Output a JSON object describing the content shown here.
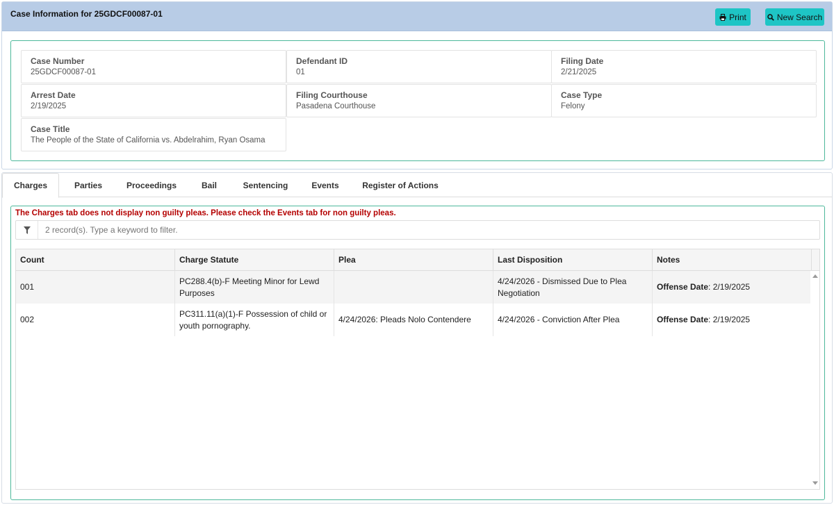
{
  "header": {
    "title": "Case Information for 25GDCF00087-01",
    "print_label": "Print",
    "new_search_label": "New Search"
  },
  "case_info": {
    "case_number": {
      "label": "Case Number",
      "value": "25GDCF00087-01"
    },
    "defendant_id": {
      "label": "Defendant ID",
      "value": "01"
    },
    "filing_date": {
      "label": "Filing Date",
      "value": "2/21/2025"
    },
    "arrest_date": {
      "label": "Arrest Date",
      "value": "2/19/2025"
    },
    "filing_courthouse": {
      "label": "Filing Courthouse",
      "value": "Pasadena Courthouse"
    },
    "case_type": {
      "label": "Case Type",
      "value": "Felony"
    },
    "case_title": {
      "label": "Case Title",
      "value": "The People of the State of California vs. Abdelrahim, Ryan Osama"
    }
  },
  "tabs": [
    {
      "label": "Charges",
      "active": true
    },
    {
      "label": "Parties",
      "active": false
    },
    {
      "label": "Proceedings",
      "active": false
    },
    {
      "label": "Bail",
      "active": false
    },
    {
      "label": "Sentencing",
      "active": false
    },
    {
      "label": "Events",
      "active": false
    },
    {
      "label": "Register of Actions",
      "active": false
    }
  ],
  "charges": {
    "warning": "The Charges tab does not display non guilty pleas. Please check the Events tab for non guilty pleas.",
    "filter_placeholder": "2 record(s). Type a keyword to filter.",
    "columns": [
      "Count",
      "Charge Statute",
      "Plea",
      "Last Disposition",
      "Notes"
    ],
    "rows": [
      {
        "count": "001",
        "statute": "PC288.4(b)-F Meeting Minor for Lewd Purposes",
        "plea": "",
        "disposition": "4/24/2026 - Dismissed Due to Plea Negotiation",
        "notes_label": "Offense Date",
        "notes_value": ": 2/19/2025"
      },
      {
        "count": "002",
        "statute": "PC311.11(a)(1)-F Possession of child or youth pornography.",
        "plea": "4/24/2026: Pleads Nolo Contendere",
        "disposition": "4/24/2026 - Conviction After Plea",
        "notes_label": "Offense Date",
        "notes_value": ": 2/19/2025"
      }
    ]
  },
  "colors": {
    "header_bg": "#b8cce6",
    "button_bg": "#1ec5c5",
    "panel_border": "#4cb89a",
    "warning_text": "#b40000"
  }
}
